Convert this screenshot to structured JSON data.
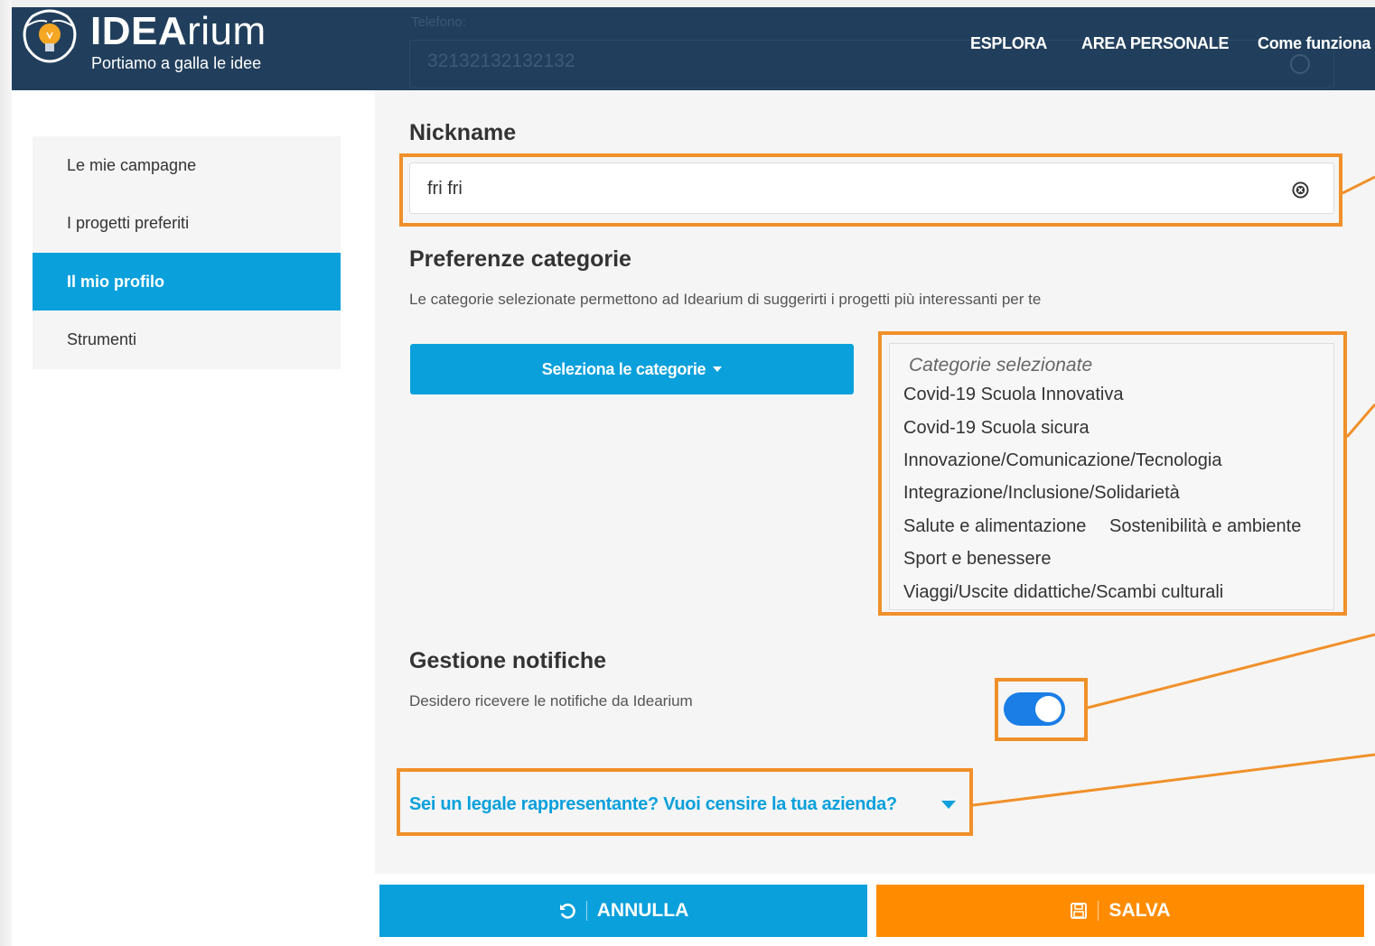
{
  "brand": {
    "name_bold": "IDEA",
    "name_light": "rium",
    "tagline": "Portiamo a galla le idee"
  },
  "background_form": {
    "phone_label": "Telefono:",
    "phone_value": "32132132132132"
  },
  "nav": {
    "explore": "ESPLORA",
    "personal_area": "AREA PERSONALE",
    "how_it_works": "Come funziona"
  },
  "sidebar": {
    "items": [
      {
        "label": "Le mie campagne",
        "active": false
      },
      {
        "label": "I progetti preferiti",
        "active": false
      },
      {
        "label": "Il mio profilo",
        "active": true
      },
      {
        "label": "Strumenti",
        "active": false
      }
    ]
  },
  "profile": {
    "nickname_heading": "Nickname",
    "nickname_value": "fri fri",
    "categories_heading": "Preferenze categorie",
    "categories_description": "Le categorie selezionate permettono ad Idearium di suggerirti i progetti più interessanti per te",
    "select_categories_button": "Seleziona le categorie",
    "selected_placeholder": "Categorie selezionate",
    "selected_categories": [
      "Covid-19 Scuola Innovativa",
      "Covid-19 Scuola sicura",
      "Innovazione/Comunicazione/Tecnologia",
      "Integrazione/Inclusione/Solidarietà",
      "Salute e alimentazione",
      "Sostenibilità e ambiente",
      "Sport e benessere",
      "Viaggi/Uscite didattiche/Scambi culturali"
    ],
    "notifications_heading": "Gestione notifiche",
    "notifications_description": "Desidero ricevere le notifiche da Idearium",
    "notifications_enabled": true,
    "legal_rep_link": "Sei un legale rappresentante? Vuoi censire la tua azienda?"
  },
  "actions": {
    "cancel": "ANNULLA",
    "save": "SALVA"
  },
  "colors": {
    "header": "#213f5c",
    "accent_blue": "#0aa0dc",
    "save_orange": "#ff8c00",
    "highlight_orange": "#f0902a",
    "toggle_blue": "#1a7ee6"
  }
}
